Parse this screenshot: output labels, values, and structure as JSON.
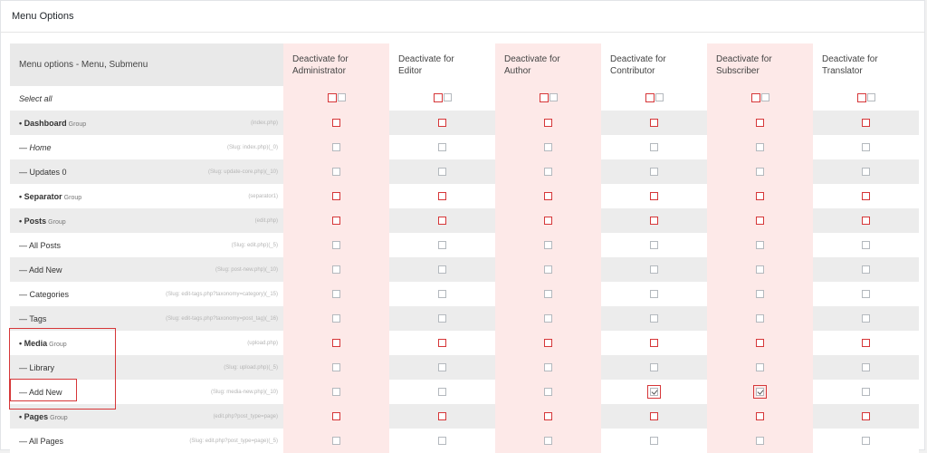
{
  "panel": {
    "title": "Menu Options"
  },
  "table": {
    "menu_header": "Menu options - Menu, Submenu",
    "role_headers": [
      "Deactivate for\nAdministrator",
      "Deactivate for\nEditor",
      "Deactivate for\nAuthor",
      "Deactivate for\nContributor",
      "Deactivate for\nSubscriber",
      "Deactivate for\nTranslator"
    ],
    "select_all_label": "Select all",
    "rows": [
      {
        "label": "• Dashboard",
        "group": "Group",
        "slug": "(index.php)",
        "type": "group",
        "italic": false
      },
      {
        "label": "— Home",
        "group": "",
        "slug": "(Slug: index.php)(_0)",
        "type": "item",
        "italic": true
      },
      {
        "label": "— Updates 0",
        "group": "",
        "slug": "(Slug: update-core.php)(_10)",
        "type": "item",
        "italic": false
      },
      {
        "label": "• Separator",
        "group": "Group",
        "slug": "(separator1)",
        "type": "group",
        "italic": false
      },
      {
        "label": "• Posts",
        "group": "Group",
        "slug": "(edit.php)",
        "type": "group",
        "italic": false
      },
      {
        "label": "— All Posts",
        "group": "",
        "slug": "(Slug: edit.php)(_5)",
        "type": "item",
        "italic": false
      },
      {
        "label": "— Add New",
        "group": "",
        "slug": "(Slug: post-new.php)(_10)",
        "type": "item",
        "italic": false
      },
      {
        "label": "— Categories",
        "group": "",
        "slug": "(Slug: edit-tags.php?taxonomy=category)(_15)",
        "type": "item",
        "italic": false
      },
      {
        "label": "— Tags",
        "group": "",
        "slug": "(Slug: edit-tags.php?taxonomy=post_tag)(_16)",
        "type": "item",
        "italic": false
      },
      {
        "label": "• Media",
        "group": "Group",
        "slug": "(upload.php)",
        "type": "group",
        "italic": false
      },
      {
        "label": "— Library",
        "group": "",
        "slug": "(Slug: upload.php)(_5)",
        "type": "item",
        "italic": false
      },
      {
        "label": "— Add New",
        "group": "",
        "slug": "(Slug: media-new.php)(_10)",
        "type": "item",
        "italic": false
      },
      {
        "label": "• Pages",
        "group": "Group",
        "slug": "(edit.php?post_type=page)",
        "type": "group",
        "italic": false
      },
      {
        "label": "— All Pages",
        "group": "",
        "slug": "(Slug: edit.php?post_type=page)(_5)",
        "type": "item",
        "italic": false
      }
    ],
    "checked": [
      {
        "row": 11,
        "col": 3
      },
      {
        "row": 11,
        "col": 4
      }
    ]
  },
  "colors": {
    "accent_red": "#d63638",
    "pink_column": "#fde9e8",
    "gray_row": "#ececec"
  }
}
